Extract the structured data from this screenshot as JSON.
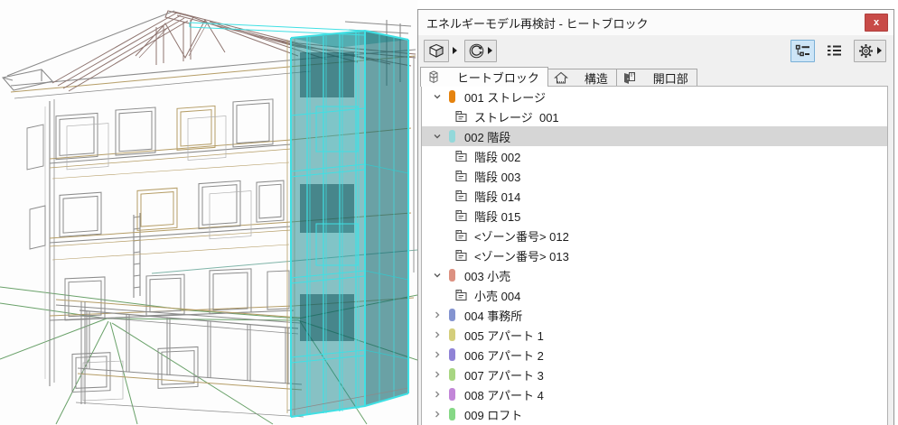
{
  "window": {
    "title": "エネルギーモデル再検討 - ヒートブロック",
    "close_label": "x"
  },
  "toolbar": {
    "left_buttons": [
      {
        "name": "3d-view",
        "icon": "cube-3d-icon",
        "has_dropdown": true
      },
      {
        "name": "update",
        "icon": "refresh-icon",
        "has_dropdown": true
      }
    ],
    "right_buttons": [
      {
        "name": "tree-view",
        "icon": "tree-list-icon",
        "selected": true
      },
      {
        "name": "flat-view",
        "icon": "flat-list-icon",
        "selected": false
      },
      {
        "name": "settings",
        "icon": "gear-icon",
        "has_dropdown": true
      }
    ]
  },
  "tabs": [
    {
      "label": "ヒートブロック",
      "icon": "heat-block-icon",
      "active": true
    },
    {
      "label": "構造",
      "icon": "structure-icon",
      "active": false
    },
    {
      "label": "開口部",
      "icon": "opening-icon",
      "active": false
    }
  ],
  "tree": {
    "items": [
      {
        "type": "group",
        "label": "001 ストレージ",
        "color": "#e5830f",
        "expanded": true,
        "selected": false
      },
      {
        "type": "zone",
        "label": "ストレージ  001"
      },
      {
        "type": "group",
        "label": "002 階段",
        "color": "#92d8da",
        "expanded": true,
        "selected": true
      },
      {
        "type": "zone",
        "label": "階段 002"
      },
      {
        "type": "zone",
        "label": "階段 003"
      },
      {
        "type": "zone",
        "label": "階段 014"
      },
      {
        "type": "zone",
        "label": "階段 015"
      },
      {
        "type": "zone",
        "label": "<ゾーン番号> 012"
      },
      {
        "type": "zone",
        "label": "<ゾーン番号> 013"
      },
      {
        "type": "group",
        "label": "003 小売",
        "color": "#dc9181",
        "expanded": true,
        "selected": false
      },
      {
        "type": "zone",
        "label": "小売 004"
      },
      {
        "type": "group",
        "label": "004 事務所",
        "color": "#8494d0",
        "expanded": false,
        "selected": false
      },
      {
        "type": "group",
        "label": "005 アパート 1",
        "color": "#d4ce7c",
        "expanded": false,
        "selected": false
      },
      {
        "type": "group",
        "label": "006 アパート 2",
        "color": "#9083d6",
        "expanded": false,
        "selected": false
      },
      {
        "type": "group",
        "label": "007 アパート 3",
        "color": "#a8d682",
        "expanded": false,
        "selected": false
      },
      {
        "type": "group",
        "label": "008 アパート 4",
        "color": "#c286d8",
        "expanded": false,
        "selected": false
      },
      {
        "type": "group",
        "label": "009 ロフト",
        "color": "#86d886",
        "expanded": false,
        "selected": false
      }
    ]
  },
  "viewport": {
    "selected_zone_fill": "#1e8c91",
    "selected_zone_edge": "#3fe0e4",
    "wire_gray": "#8b8b8b",
    "wire_tan": "#b59d66",
    "wire_brown": "#8f7570",
    "wire_green": "#69a169"
  }
}
